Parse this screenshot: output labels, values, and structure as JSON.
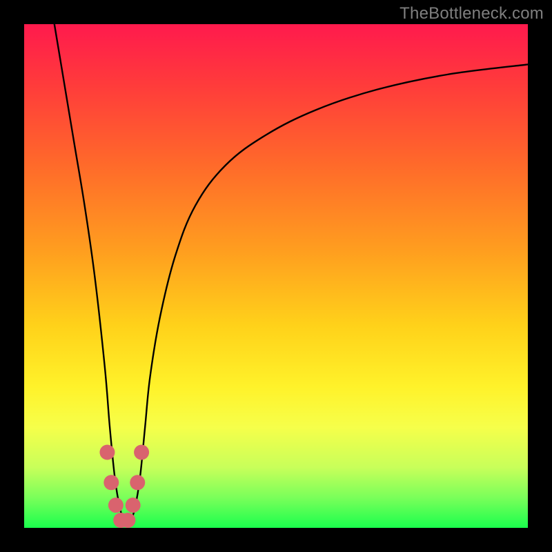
{
  "watermark": "TheBottleneck.com",
  "chart_data": {
    "type": "line",
    "title": "",
    "xlabel": "",
    "ylabel": "",
    "xlim": [
      0,
      100
    ],
    "ylim": [
      0,
      100
    ],
    "series": [
      {
        "name": "bottleneck-curve",
        "x": [
          6,
          8,
          10,
          12,
          14,
          16,
          17,
          18,
          19,
          20,
          21,
          22,
          23,
          24,
          25,
          27,
          30,
          34,
          40,
          48,
          58,
          70,
          84,
          100
        ],
        "y": [
          100,
          88,
          76,
          64,
          50,
          32,
          20,
          10,
          4,
          1,
          1,
          4,
          10,
          20,
          30,
          42,
          54,
          64,
          72,
          78,
          83,
          87,
          90,
          92
        ]
      }
    ],
    "markers": {
      "name": "highlight-points",
      "x": [
        16.5,
        17.3,
        18.2,
        19.2,
        20.6,
        21.6,
        22.5,
        23.3
      ],
      "y": [
        15,
        9,
        4.5,
        1.5,
        1.5,
        4.5,
        9,
        15
      ],
      "color": "#d9636e",
      "radius_px": 11
    }
  }
}
